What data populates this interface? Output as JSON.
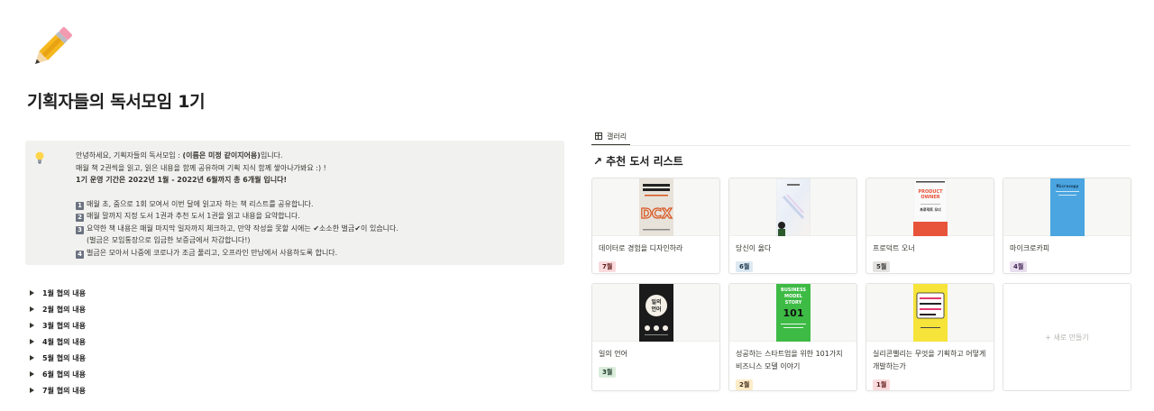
{
  "page": {
    "icon": "pencil-icon",
    "title": "기획자들의 독서모임 1기"
  },
  "callout": {
    "icon": "lightbulb-icon",
    "line1_a": "안녕하세요, 기획자들의 독서모임 : ",
    "line1_b": "(이름은 미정 같이지어용)",
    "line1_c": "입니다.",
    "line2": "매월 책 2권씩을 읽고, 읽은 내용을 함께 공유하며 기획 지식 함께 쌓아나가봐요 :) !",
    "line3": "1기 운영 기간은 2022년 1월 - 2022년 6월까지 총 6개월 입니다!",
    "rules": [
      {
        "num": "1",
        "text": "매월 초, 줌으로 1회 모여서 이번 달에 읽고자 하는 책 리스트를 공유합니다."
      },
      {
        "num": "2",
        "text": "매월 말까지 지정 도서 1권과 추천 도서 1권을 읽고 내용을 요약합니다."
      },
      {
        "num": "3",
        "text": "요약한 책 내용은 매월 마지막 일자까지 체크하고, 만약 작성을 못할 시에는 ✔소소한 벌금✔이 있습니다."
      },
      {
        "num": "",
        "text": "(벌금은 모임통장으로 입금한 보증금에서 차감합니다!)"
      },
      {
        "num": "4",
        "text": "벌금은 모아서 나중에 코로나가 조금 풀리고, 오프라인 만남에서 사용하도록 합니다."
      }
    ]
  },
  "toggles": [
    "1월 협의 내용",
    "2월 협의 내용",
    "3월 협의 내용",
    "4월 협의 내용",
    "5월 협의 내용",
    "6월 협의 내용",
    "7월 협의 내용"
  ],
  "gallery": {
    "tab_label": "갤러리",
    "tab_icon": "table-grid-icon",
    "section_title": "추천 도서 리스트",
    "section_icon": "arrow-up-right-icon",
    "new_label": "+ 새로 만들기",
    "cards": [
      {
        "title": "데이터로 경험을 디자인하라",
        "tag": "7월",
        "tag_bg": "#fadbdd",
        "tag_fg": "#5d1715"
      },
      {
        "title": "당신이 옳다",
        "tag": "6월",
        "tag_bg": "#dde9f2",
        "tag_fg": "#183347"
      },
      {
        "title": "프로덕트 오너",
        "tag": "5월",
        "tag_bg": "#e3e2e0",
        "tag_fg": "#32302c"
      },
      {
        "title": "마이크로카피",
        "tag": "4월",
        "tag_bg": "#e8deee",
        "tag_fg": "#412454"
      },
      {
        "title": "일의 언어",
        "tag": "3월",
        "tag_bg": "#dbeddb",
        "tag_fg": "#1c3829"
      },
      {
        "title": "성공하는 스타트업을 위한 101가지 비즈니스 모델 이야기",
        "tag": "2월",
        "tag_bg": "#fdecc8",
        "tag_fg": "#402c1b"
      },
      {
        "title": "실리콘밸리는 무엇을 기획하고 어떻게 개발하는가",
        "tag": "1월",
        "tag_bg": "#fadbdd",
        "tag_fg": "#5d1715"
      }
    ]
  }
}
